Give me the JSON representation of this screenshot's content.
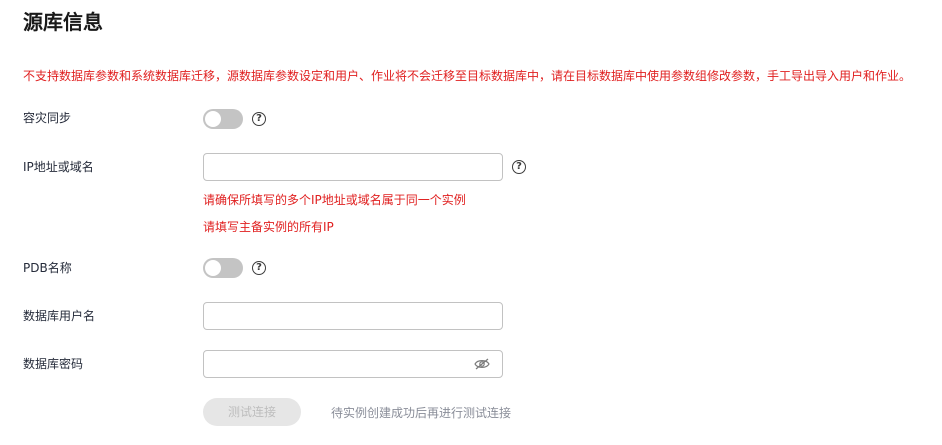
{
  "section": {
    "title": "源库信息",
    "warning": "不支持数据库参数和系统数据库迁移，源数据库参数设定和用户、作业将不会迁移至目标数据库中，请在目标数据库中使用参数组修改参数，手工导出导入用户和作业。"
  },
  "fields": {
    "disaster_sync": {
      "label": "容灾同步",
      "enabled": false
    },
    "ip_domain": {
      "label": "IP地址或域名",
      "value": "",
      "hint_1": "请确保所填写的多个IP地址或域名属于同一个实例",
      "hint_2": "请填写主备实例的所有IP"
    },
    "pdb_name": {
      "label": "PDB名称",
      "enabled": false
    },
    "db_user": {
      "label": "数据库用户名",
      "value": ""
    },
    "db_password": {
      "label": "数据库密码",
      "value": "",
      "icon": "eye-hidden-icon"
    }
  },
  "actions": {
    "test_connection_label": "测试连接",
    "test_connection_note": "待实例创建成功后再进行测试连接"
  },
  "colors": {
    "warning": "#e02020",
    "toggle_off": "#c4c4c4",
    "disabled_button_bg": "#e6e6e6",
    "note_text": "#8a8e99"
  }
}
